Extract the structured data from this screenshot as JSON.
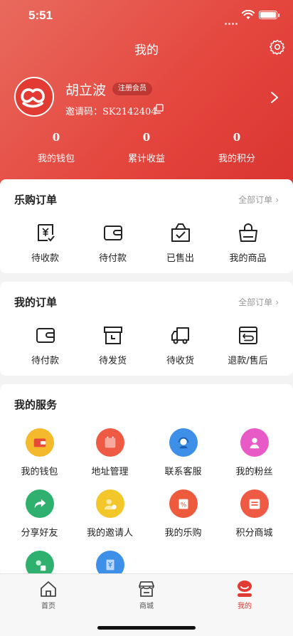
{
  "status_bar": {
    "time": "5:51"
  },
  "header": {
    "title": "我的"
  },
  "profile": {
    "name": "胡立波",
    "badge": "注册会员",
    "invite_label": "邀请码：",
    "invite_code": "SK2142404"
  },
  "stats": [
    {
      "value": "0",
      "label": "我的钱包"
    },
    {
      "value": "0",
      "label": "累计收益"
    },
    {
      "value": "0",
      "label": "我的积分"
    }
  ],
  "legou_orders": {
    "title": "乐购订单",
    "more": "全部订单",
    "items": [
      {
        "label": "待收款",
        "icon": "yen-check-icon"
      },
      {
        "label": "待付款",
        "icon": "wallet-icon"
      },
      {
        "label": "已售出",
        "icon": "bag-check-icon"
      },
      {
        "label": "我的商品",
        "icon": "shopping-bag-icon"
      }
    ]
  },
  "my_orders": {
    "title": "我的订单",
    "more": "全部订单",
    "items": [
      {
        "label": "待付款",
        "icon": "wallet-icon"
      },
      {
        "label": "待发货",
        "icon": "box-clock-icon"
      },
      {
        "label": "待收货",
        "icon": "truck-icon"
      },
      {
        "label": "退款/售后",
        "icon": "return-icon"
      }
    ]
  },
  "services": {
    "title": "我的服务",
    "items": [
      {
        "label": "我的钱包",
        "icon": "wallet-icon",
        "color": "#f5b92c"
      },
      {
        "label": "地址管理",
        "icon": "location-icon",
        "color": "#ef5a45"
      },
      {
        "label": "联系客服",
        "icon": "headset-icon",
        "color": "#3d8fe8"
      },
      {
        "label": "我的粉丝",
        "icon": "fans-icon",
        "color": "#e85bc6"
      },
      {
        "label": "分享好友",
        "icon": "share-icon",
        "color": "#2fb06e"
      },
      {
        "label": "我的邀请人",
        "icon": "inviter-icon",
        "color": "#f3c62a"
      },
      {
        "label": "我的乐购",
        "icon": "discount-icon",
        "color": "#ee5a3c"
      },
      {
        "label": "积分商城",
        "icon": "points-icon",
        "color": "#ef5a45"
      },
      {
        "label": "",
        "icon": "service-user-icon",
        "color": "#2fb06e"
      },
      {
        "label": "",
        "icon": "yen-doc-icon",
        "color": "#3d8fe8"
      }
    ]
  },
  "tabbar": {
    "items": [
      {
        "label": "首页",
        "icon": "home-icon"
      },
      {
        "label": "商城",
        "icon": "store-icon"
      },
      {
        "label": "我的",
        "icon": "profile-icon"
      }
    ]
  },
  "colors": {
    "primary": "#e13b33",
    "header_gradient_start": "#e96a5e",
    "header_gradient_end": "#d9322f"
  }
}
